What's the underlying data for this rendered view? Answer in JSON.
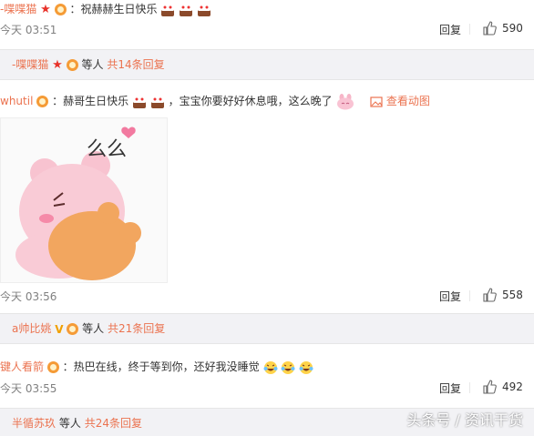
{
  "comments": [
    {
      "user": "-喋喋猫",
      "text": "：祝赫赫生日快乐",
      "time": "今天 03:51",
      "reply": "回复",
      "likes": "590"
    },
    {
      "user": "whutil",
      "text_a": "：赫哥生日快乐",
      "text_b": "，宝宝你要好好休息哦，这么晚了",
      "view_gif": "查看动图",
      "time": "今天 03:56",
      "reply": "回复",
      "likes": "558"
    },
    {
      "user": "键人看箭",
      "text": "：热巴在线，终于等到你，还好我没睡觉",
      "time": "今天 03:55",
      "reply": "回复",
      "likes": "492"
    }
  ],
  "subthreads": [
    {
      "user": "-喋喋猫",
      "others": "等人",
      "count": "共14条回复"
    },
    {
      "user": "a帅比姚",
      "others": "等人",
      "count": "共21条回复"
    },
    {
      "user": "半循苏玖",
      "others": "等人",
      "count": "共24条回复"
    }
  ],
  "sticker": {
    "text": "么么"
  },
  "watermark": "头条号 / 资讯干货",
  "colors": {
    "username": "#eb7350",
    "subbar_bg": "#f2f2f5",
    "time": "#808080"
  }
}
